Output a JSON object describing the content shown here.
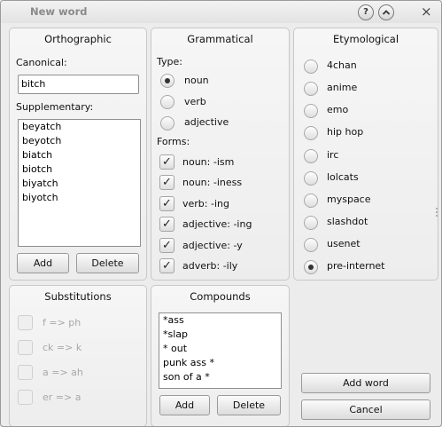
{
  "window": {
    "title": "New word",
    "help_icon": "?",
    "collapse_icon": "^",
    "close_icon": "×"
  },
  "orthographic": {
    "title": "Orthographic",
    "canonical_label": "Canonical:",
    "canonical_value": "bitch",
    "supplementary_label": "Supplementary:",
    "supplementary": [
      "beyatch",
      "beyotch",
      "biatch",
      "biotch",
      "biyatch",
      "biyotch"
    ],
    "add_label": "Add",
    "delete_label": "Delete"
  },
  "grammatical": {
    "title": "Grammatical",
    "type_label": "Type:",
    "types": [
      {
        "label": "noun",
        "selected": true
      },
      {
        "label": "verb",
        "selected": false
      },
      {
        "label": "adjective",
        "selected": false
      }
    ],
    "forms_label": "Forms:",
    "forms": [
      {
        "label": "noun: -ism",
        "checked": true
      },
      {
        "label": "noun: -iness",
        "checked": true
      },
      {
        "label": "verb: -ing",
        "checked": true
      },
      {
        "label": "adjective: -ing",
        "checked": true
      },
      {
        "label": "adjective: -y",
        "checked": true
      },
      {
        "label": "adverb: -ily",
        "checked": true
      }
    ]
  },
  "etymological": {
    "title": "Etymological",
    "options": [
      {
        "label": "4chan",
        "selected": false
      },
      {
        "label": "anime",
        "selected": false
      },
      {
        "label": "emo",
        "selected": false
      },
      {
        "label": "hip hop",
        "selected": false
      },
      {
        "label": "irc",
        "selected": false
      },
      {
        "label": "lolcats",
        "selected": false
      },
      {
        "label": "myspace",
        "selected": false
      },
      {
        "label": "slashdot",
        "selected": false
      },
      {
        "label": "usenet",
        "selected": false
      },
      {
        "label": "pre-internet",
        "selected": true
      }
    ]
  },
  "substitutions": {
    "title": "Substitutions",
    "items": [
      {
        "label": "f => ph",
        "checked": false,
        "disabled": true
      },
      {
        "label": "ck => k",
        "checked": false,
        "disabled": true
      },
      {
        "label": "a => ah",
        "checked": false,
        "disabled": true
      },
      {
        "label": "er => a",
        "checked": false,
        "disabled": true
      }
    ]
  },
  "compounds": {
    "title": "Compounds",
    "items": [
      "*ass",
      "*slap",
      "* out",
      "punk ass *",
      "son of a *"
    ],
    "add_label": "Add",
    "delete_label": "Delete"
  },
  "actions": {
    "add_word_label": "Add word",
    "cancel_label": "Cancel"
  }
}
